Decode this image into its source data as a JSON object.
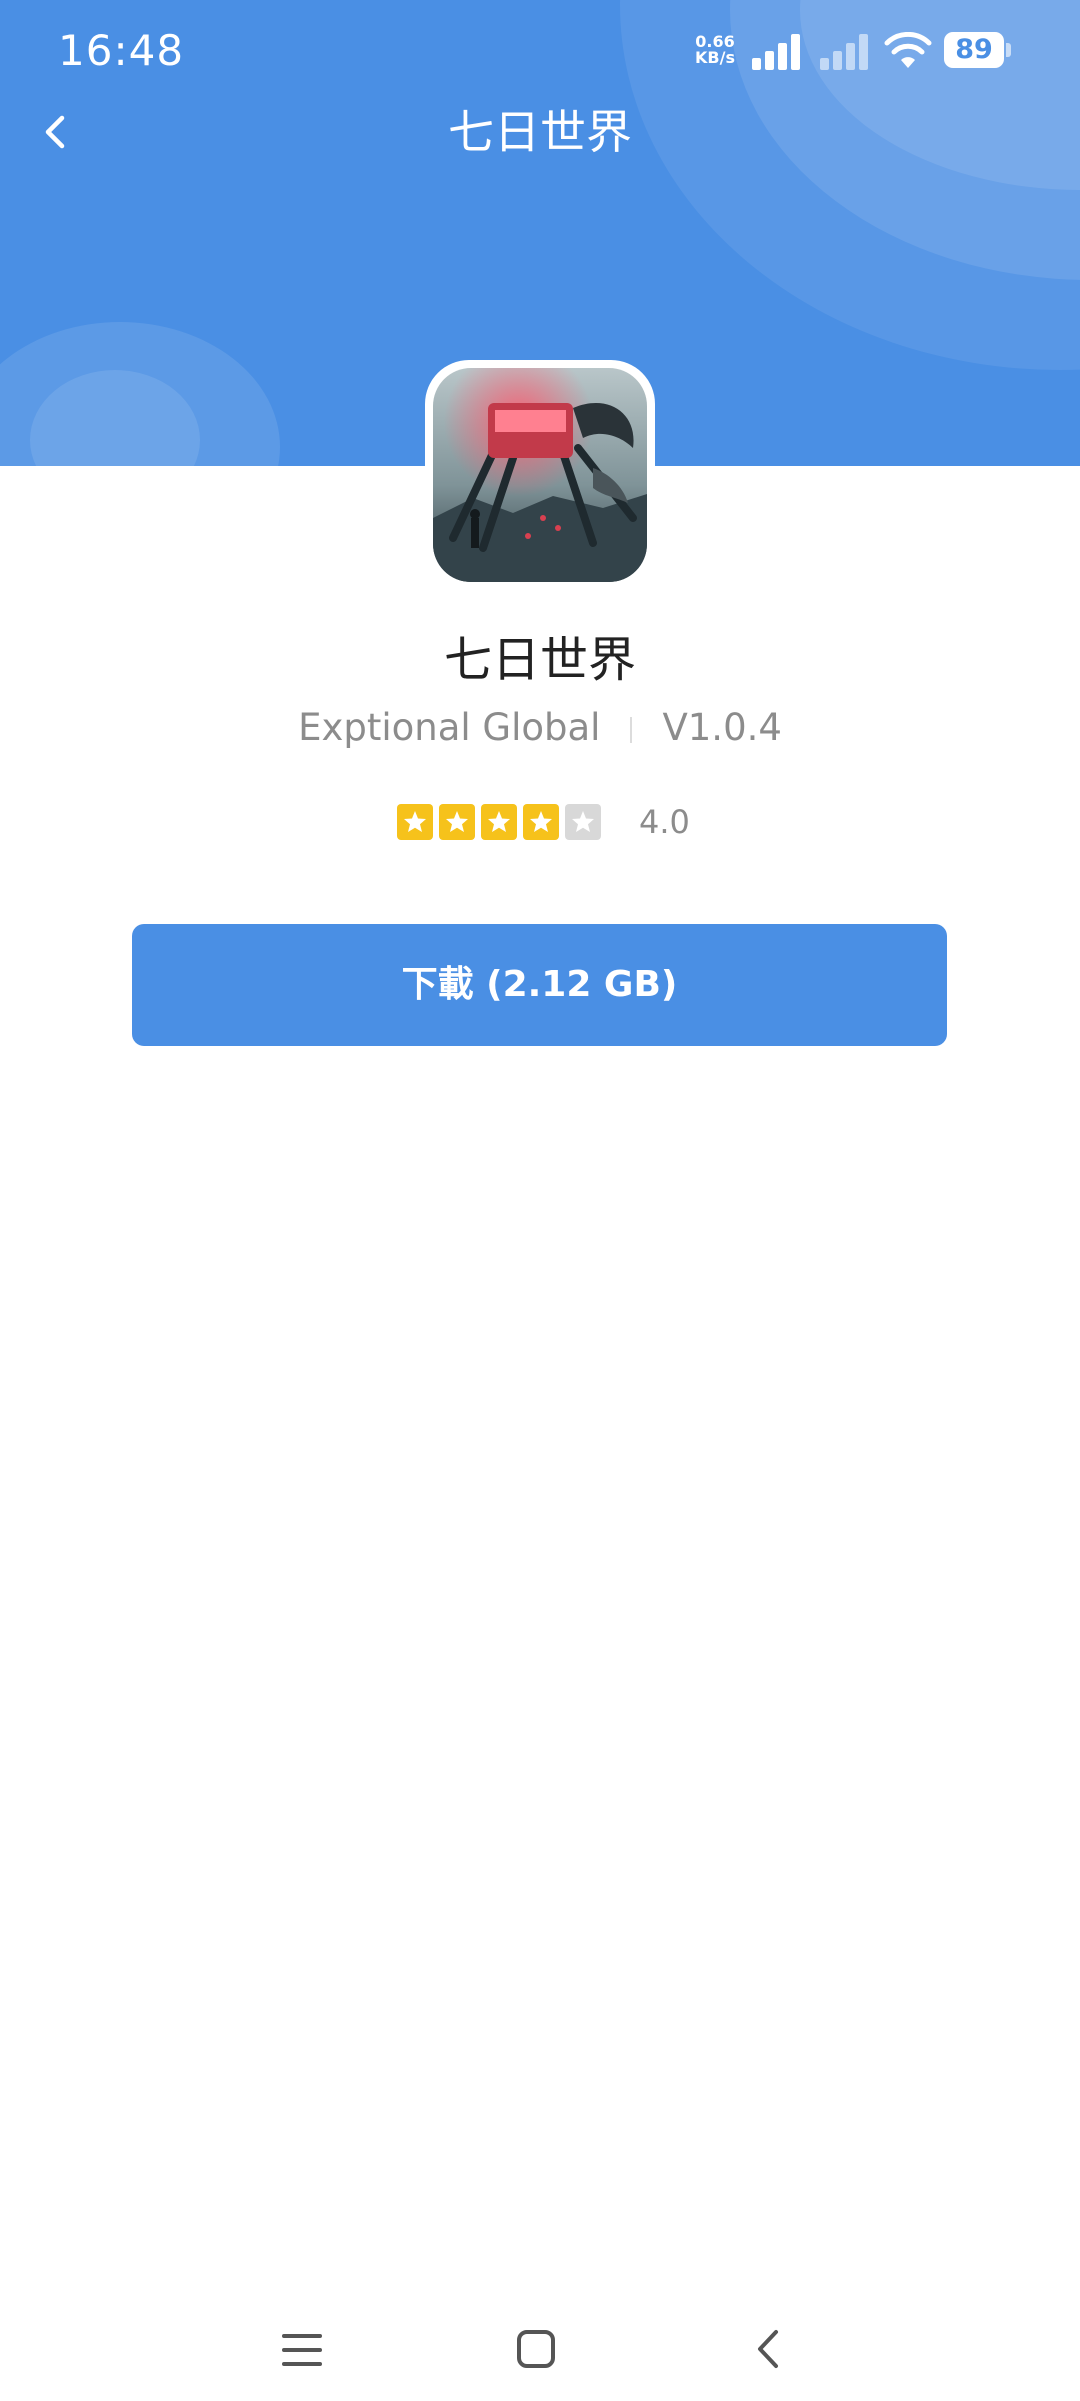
{
  "status_bar": {
    "time": "16:48",
    "net_speed_value": "0.66",
    "net_speed_unit": "KB/s",
    "battery_level": "89"
  },
  "header": {
    "title": "七日世界"
  },
  "app": {
    "name": "七日世界",
    "developer": "Exptional Global",
    "version": "V1.0.4",
    "rating": 4.0,
    "rating_text": "4.0",
    "rating_max": 5
  },
  "download_button": {
    "label": "下載 (2.12 GB)"
  },
  "colors": {
    "header_bg": "#4a8fe4",
    "button_bg": "#4a8fe4",
    "star_filled": "#f6c21b",
    "star_empty": "#d8d8d8"
  },
  "icons": {
    "back": "chevron-left-icon",
    "nav_menu": "menu-icon",
    "nav_home": "home-icon",
    "nav_back": "back-icon"
  }
}
